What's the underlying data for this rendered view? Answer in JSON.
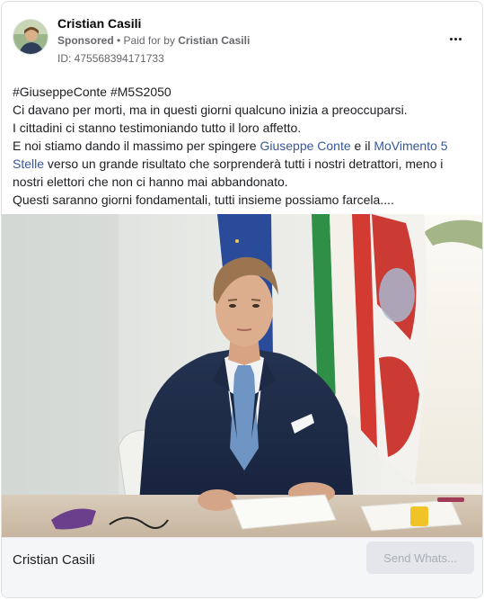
{
  "post": {
    "author": "Cristian Casili",
    "sponsored_label": "Sponsored",
    "separator": " • ",
    "paid_for_prefix": "Paid for by ",
    "paid_for_name": "Cristian Casili",
    "ad_id": "ID: 475568394171733"
  },
  "body": {
    "hashtags": "#GiuseppeConte #M5S2050",
    "line1": "Ci davano per morti, ma in questi giorni qualcuno inizia a preoccuparsi.",
    "line2": "I cittadini ci stanno testimoniando tutto il loro affetto.",
    "line3_start": "E noi stiamo dando il massimo per spingere ",
    "link1": "Giuseppe Conte",
    "line3_mid": " e il ",
    "link2": "MoVimento 5 Stelle",
    "line3_end": " verso un grande risultato che sorprenderà tutti i nostri detrattori, meno i nostri elettori che non ci hanno mai abbandonato.",
    "line4": "Questi saranno giorni fondamentali, tutti insieme possiamo farcela...."
  },
  "footer": {
    "title": "Cristian Casili",
    "cta_label": "Send Whats..."
  },
  "icons": {
    "more": "more-options-icon"
  }
}
